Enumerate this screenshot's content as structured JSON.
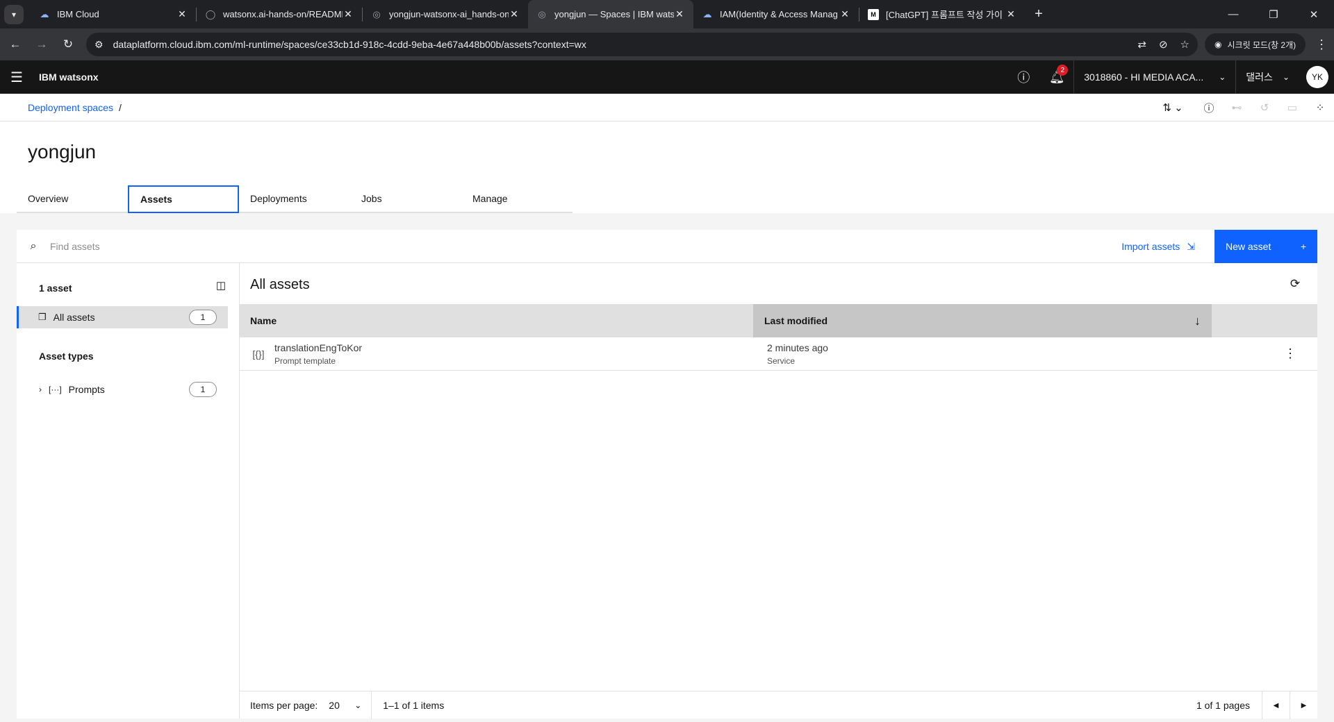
{
  "browser": {
    "tabs": [
      {
        "title": "IBM Cloud",
        "icon": "ibm-cloud-icon",
        "active": false
      },
      {
        "title": "watsonx.ai-hands-on/README",
        "icon": "github-icon",
        "active": false
      },
      {
        "title": "yongjun-watsonx-ai_hands-on",
        "icon": "watsonx-icon",
        "active": false
      },
      {
        "title": "yongjun — Spaces | IBM wats",
        "icon": "watsonx-icon",
        "active": true
      },
      {
        "title": "IAM(Identity & Access Manag",
        "icon": "ibm-cloud-icon",
        "active": false
      },
      {
        "title": "[ChatGPT] 프롬프트 작성 가이",
        "icon": "medium-icon",
        "active": false
      }
    ],
    "url": "dataplatform.cloud.ibm.com/ml-runtime/spaces/ce33cb1d-918c-4cdd-9eba-4e67a448b00b/assets?context=wx",
    "incognito_label": "시크릿 모드(창 2개)"
  },
  "header": {
    "brand": "IBM watsonx",
    "notification_count": "2",
    "account": "3018860 - HI MEDIA ACA...",
    "region": "댈러스",
    "avatar": "YK"
  },
  "breadcrumb": {
    "link": "Deployment spaces",
    "separator": "/"
  },
  "page": {
    "title": "yongjun",
    "tabs": [
      {
        "label": "Overview",
        "active": false
      },
      {
        "label": "Assets",
        "active": true
      },
      {
        "label": "Deployments",
        "active": false
      },
      {
        "label": "Jobs",
        "active": false
      },
      {
        "label": "Manage",
        "active": false
      }
    ]
  },
  "toolbar": {
    "search_placeholder": "Find assets",
    "import_label": "Import assets",
    "new_label": "New asset"
  },
  "left_panel": {
    "count_label": "1 asset",
    "all_assets_label": "All assets",
    "all_assets_count": "1",
    "types_heading": "Asset types",
    "types": [
      {
        "label": "Prompts",
        "count": "1"
      }
    ]
  },
  "main": {
    "title": "All assets",
    "columns": {
      "name": "Name",
      "modified": "Last modified"
    },
    "rows": [
      {
        "name": "translationEngToKor",
        "type": "Prompt template",
        "modified": "2 minutes ago",
        "modified_by": "Service"
      }
    ]
  },
  "pagination": {
    "items_per_page_label": "Items per page:",
    "items_per_page": "20",
    "range": "1–1 of 1 items",
    "pages": "1 of 1 pages"
  }
}
